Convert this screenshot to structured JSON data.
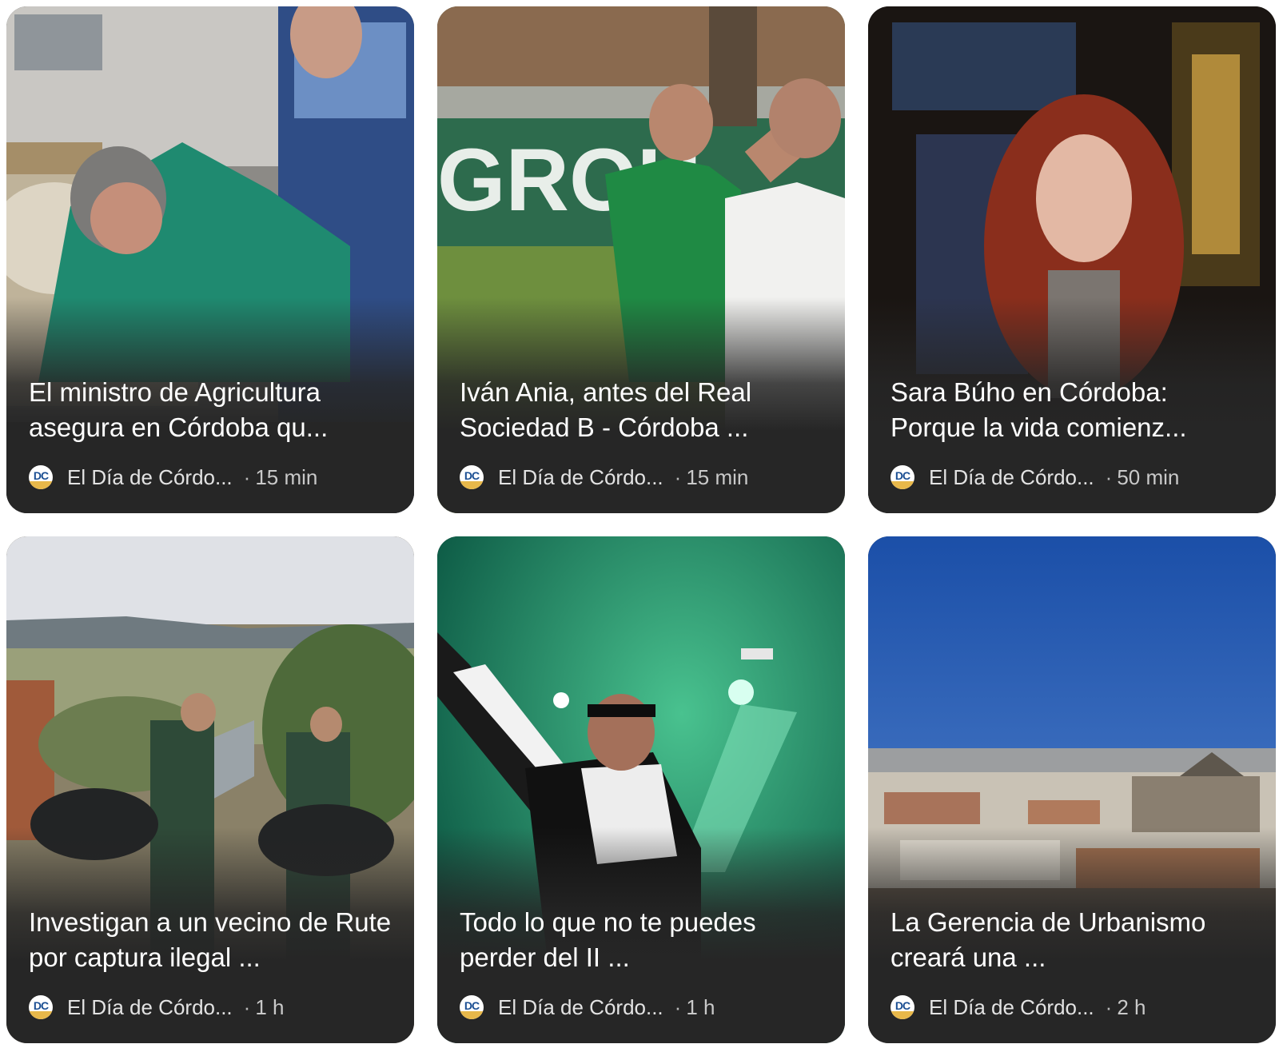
{
  "articles": [
    {
      "headline": "El ministro de Agricultura asegura en Córdoba qu...",
      "source": "El Día de Córdo...",
      "age": "15 min",
      "logo_text": "DC"
    },
    {
      "headline": "Iván Ania, antes del Real Sociedad B - Córdoba ...",
      "source": "El Día de Córdo...",
      "age": "15 min",
      "logo_text": "DC",
      "photo_text": "GROU"
    },
    {
      "headline": "Sara Búho en Córdoba: Porque la vida comienz...",
      "source": "El Día de Córdo...",
      "age": "50 min",
      "logo_text": "DC"
    },
    {
      "headline": "Investigan a un vecino de Rute por captura ilegal ...",
      "source": "El Día de Córdo...",
      "age": "1 h",
      "logo_text": "DC"
    },
    {
      "headline": "Todo lo que no te puedes perder del II ...",
      "source": "El Día de Córdo...",
      "age": "1 h",
      "logo_text": "DC"
    },
    {
      "headline": "La Gerencia de Urbanismo creará una ...",
      "source": "El Día de Córdo...",
      "age": "2 h",
      "logo_text": "DC"
    }
  ],
  "separator": "·"
}
